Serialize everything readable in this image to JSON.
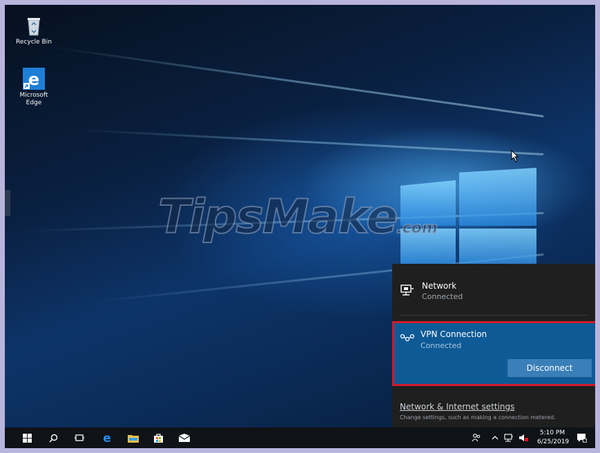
{
  "desktop": {
    "icons": [
      {
        "label": "Recycle Bin",
        "icon": "recycle-bin-icon"
      },
      {
        "label": "Microsoft Edge",
        "icon": "edge-icon"
      }
    ],
    "watermark": {
      "main": "TipsMake",
      "suffix": ".com"
    }
  },
  "network_flyout": {
    "network": {
      "title": "Network",
      "status": "Connected",
      "icon": "ethernet-icon"
    },
    "vpn": {
      "title": "VPN Connection",
      "status": "Connected",
      "icon": "vpn-icon",
      "button_label": "Disconnect"
    },
    "settings": {
      "link": "Network & Internet settings",
      "description": "Change settings, such as making a connection metered."
    }
  },
  "taskbar": {
    "buttons": [
      "start-icon",
      "search-icon",
      "task-view-icon",
      "edge-icon",
      "file-explorer-icon",
      "store-icon",
      "mail-icon"
    ],
    "tray": {
      "time": "5:10 PM",
      "date": "6/25/2019"
    }
  },
  "colors": {
    "accent": "#0e5a96",
    "highlight": "#d11a2a",
    "button": "#3a7fb8"
  }
}
